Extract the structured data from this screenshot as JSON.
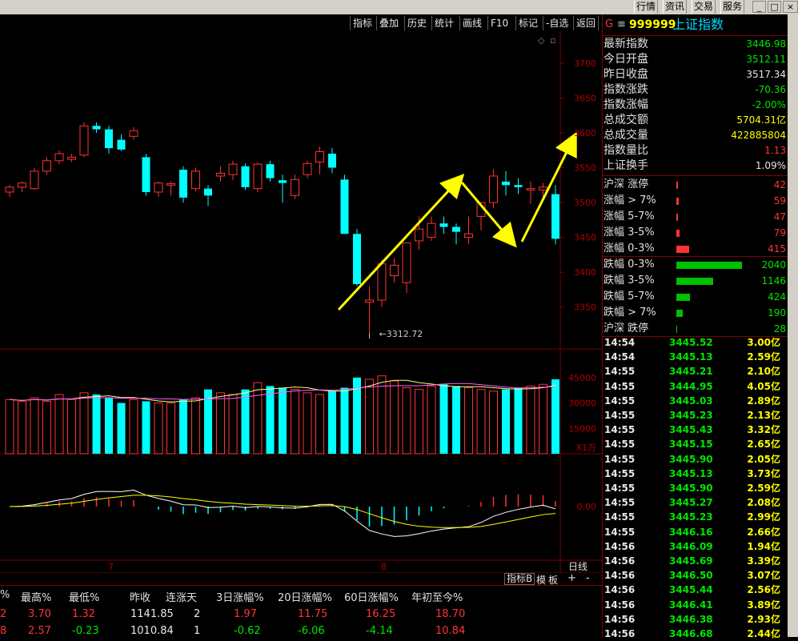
{
  "topbar": {
    "menus": [
      "行情",
      "资讯",
      "交易",
      "服务"
    ],
    "win_buttons": [
      "_",
      "□",
      "×"
    ]
  },
  "toolbar": {
    "items": [
      "指标",
      "叠加",
      "历史",
      "统计",
      "画线",
      "F10",
      "标记",
      "-自选",
      "返回"
    ]
  },
  "chart": {
    "price_axis": [
      "3700",
      "3650",
      "3600",
      "3550",
      "3500",
      "3450",
      "3400",
      "3350"
    ],
    "low_label": "←3312.72",
    "vol_axis": [
      "45000",
      "30000",
      "15000"
    ],
    "vol_unit": "X1万",
    "macd_axis": "0.00",
    "x_labels": [
      "7",
      "8"
    ],
    "period": "日线",
    "bottom_tabs": [
      "指标B",
      "模",
      "板",
      "+",
      "-"
    ]
  },
  "chart_data": {
    "type": "candlestick",
    "ylim": [
      3290,
      3740
    ],
    "candles": [
      [
        3515,
        3525,
        3508,
        3522
      ],
      [
        3522,
        3530,
        3515,
        3528
      ],
      [
        3520,
        3550,
        3518,
        3545
      ],
      [
        3545,
        3565,
        3540,
        3560
      ],
      [
        3560,
        3575,
        3555,
        3570
      ],
      [
        3562,
        3570,
        3558,
        3565
      ],
      [
        3568,
        3615,
        3565,
        3610
      ],
      [
        3610,
        3615,
        3600,
        3605
      ],
      [
        3605,
        3610,
        3570,
        3578
      ],
      [
        3590,
        3598,
        3574,
        3576
      ],
      [
        3595,
        3608,
        3590,
        3603
      ],
      [
        3565,
        3570,
        3510,
        3515
      ],
      [
        3515,
        3530,
        3508,
        3528
      ],
      [
        3525,
        3530,
        3510,
        3527
      ],
      [
        3547,
        3552,
        3500,
        3507
      ],
      [
        3520,
        3550,
        3516,
        3545
      ],
      [
        3520,
        3525,
        3495,
        3510
      ],
      [
        3538,
        3552,
        3530,
        3542
      ],
      [
        3540,
        3560,
        3532,
        3555
      ],
      [
        3552,
        3556,
        3518,
        3522
      ],
      [
        3520,
        3558,
        3515,
        3555
      ],
      [
        3555,
        3560,
        3530,
        3535
      ],
      [
        3532,
        3540,
        3500,
        3528
      ],
      [
        3510,
        3540,
        3505,
        3533
      ],
      [
        3540,
        3560,
        3535,
        3556
      ],
      [
        3558,
        3580,
        3540,
        3573
      ],
      [
        3570,
        3578,
        3542,
        3550
      ],
      [
        3533,
        3540,
        3460,
        3455
      ],
      [
        3455,
        3462,
        3380,
        3383
      ],
      [
        3357,
        3380,
        3312,
        3360
      ],
      [
        3360,
        3418,
        3350,
        3412
      ],
      [
        3395,
        3420,
        3385,
        3410
      ],
      [
        3385,
        3420,
        3370,
        3442
      ],
      [
        3445,
        3480,
        3432,
        3462
      ],
      [
        3450,
        3480,
        3445,
        3470
      ],
      [
        3470,
        3480,
        3455,
        3465
      ],
      [
        3465,
        3470,
        3440,
        3458
      ],
      [
        3450,
        3480,
        3440,
        3455
      ],
      [
        3480,
        3495,
        3460,
        3500
      ],
      [
        3500,
        3548,
        3492,
        3538
      ],
      [
        3530,
        3545,
        3510,
        3525
      ],
      [
        3525,
        3535,
        3512,
        3522
      ],
      [
        3518,
        3530,
        3498,
        3520
      ],
      [
        3518,
        3528,
        3505,
        3522
      ],
      [
        3512,
        3525,
        3440,
        3448
      ]
    ],
    "volume": [
      32000,
      31000,
      33000,
      31000,
      35000,
      32000,
      36000,
      35000,
      33000,
      30000,
      32000,
      31000,
      30000,
      30000,
      32000,
      33000,
      38000,
      36000,
      35000,
      38000,
      42000,
      40000,
      39000,
      38000,
      36000,
      35000,
      37000,
      39000,
      45000,
      44000,
      46000,
      43000,
      39000,
      38000,
      40000,
      41000,
      40000,
      39000,
      38000,
      37000,
      38000,
      39000,
      40000,
      41000,
      44000
    ],
    "annotations": [
      "3312.72"
    ]
  },
  "quote": {
    "code": "999999",
    "name": "上证指数",
    "mark": "G",
    "rows": [
      {
        "label": "最新指数",
        "value": "3446.98",
        "color": "#00e600"
      },
      {
        "label": "今日开盘",
        "value": "3512.11",
        "color": "#00e600"
      },
      {
        "label": "昨日收盘",
        "value": "3517.34",
        "color": "#e8e8e8"
      },
      {
        "label": "指数涨跌",
        "value": "-70.36",
        "color": "#00e600"
      },
      {
        "label": "指数涨幅",
        "value": "-2.00%",
        "color": "#00e600"
      },
      {
        "label": "总成交额",
        "value": "5704.31亿",
        "color": "#ffff00"
      },
      {
        "label": "总成交量",
        "value": "422885804",
        "color": "#ffff00"
      },
      {
        "label": "指数量比",
        "value": "1.13",
        "color": "#ff3333"
      },
      {
        "label": "上证换手",
        "value": "1.09%",
        "color": "#e8e8e8"
      }
    ],
    "breadth_up": [
      {
        "label": "沪深 涨停",
        "value": "42",
        "bar": 2
      },
      {
        "label": "涨幅 > 7%",
        "value": "59",
        "bar": 3
      },
      {
        "label": "涨幅 5-7%",
        "value": "47",
        "bar": 2
      },
      {
        "label": "涨幅 3-5%",
        "value": "79",
        "bar": 4
      },
      {
        "label": "涨幅 0-3%",
        "value": "415",
        "bar": 16
      }
    ],
    "breadth_down": [
      {
        "label": "跌幅 0-3%",
        "value": "2040",
        "bar": 82
      },
      {
        "label": "跌幅 3-5%",
        "value": "1146",
        "bar": 46
      },
      {
        "label": "跌幅 5-7%",
        "value": "424",
        "bar": 17
      },
      {
        "label": "跌幅 > 7%",
        "value": "190",
        "bar": 8
      },
      {
        "label": "沪深 跌停",
        "value": "28",
        "bar": 1
      }
    ],
    "ticks": [
      [
        "14:54",
        "3445.52",
        "3.00亿"
      ],
      [
        "14:54",
        "3445.13",
        "2.59亿"
      ],
      [
        "14:55",
        "3445.21",
        "2.10亿"
      ],
      [
        "14:55",
        "3444.95",
        "4.05亿"
      ],
      [
        "14:55",
        "3445.03",
        "2.89亿"
      ],
      [
        "14:55",
        "3445.23",
        "2.13亿"
      ],
      [
        "14:55",
        "3445.43",
        "3.32亿"
      ],
      [
        "14:55",
        "3445.15",
        "2.65亿"
      ],
      [
        "14:55",
        "3445.90",
        "2.05亿"
      ],
      [
        "14:55",
        "3445.13",
        "3.73亿"
      ],
      [
        "14:55",
        "3445.90",
        "2.59亿"
      ],
      [
        "14:55",
        "3445.27",
        "2.08亿"
      ],
      [
        "14:55",
        "3445.23",
        "2.99亿"
      ],
      [
        "14:55",
        "3446.16",
        "2.66亿"
      ],
      [
        "14:56",
        "3446.09",
        "1.94亿"
      ],
      [
        "14:56",
        "3445.69",
        "3.39亿"
      ],
      [
        "14:56",
        "3446.50",
        "3.07亿"
      ],
      [
        "14:56",
        "3445.44",
        "2.56亿"
      ],
      [
        "14:56",
        "3446.41",
        "3.89亿"
      ],
      [
        "14:56",
        "3446.38",
        "2.93亿"
      ],
      [
        "14:56",
        "3446.68",
        "2.44亿"
      ]
    ]
  },
  "bottom_table": {
    "headers": [
      "%",
      "最高%",
      "最低%",
      "昨收",
      "连涨天",
      "3日涨幅%",
      "20日涨幅%",
      "60日涨幅%",
      "年初至今%"
    ],
    "rows": [
      [
        "2",
        "3.70",
        "1.32",
        "1141.85",
        "2",
        "1.97",
        "11.75",
        "16.25",
        "18.70"
      ],
      [
        "8",
        "2.57",
        "-0.23",
        "1010.84",
        "1",
        "-0.62",
        "-6.06",
        "-4.14",
        "10.84"
      ]
    ]
  }
}
